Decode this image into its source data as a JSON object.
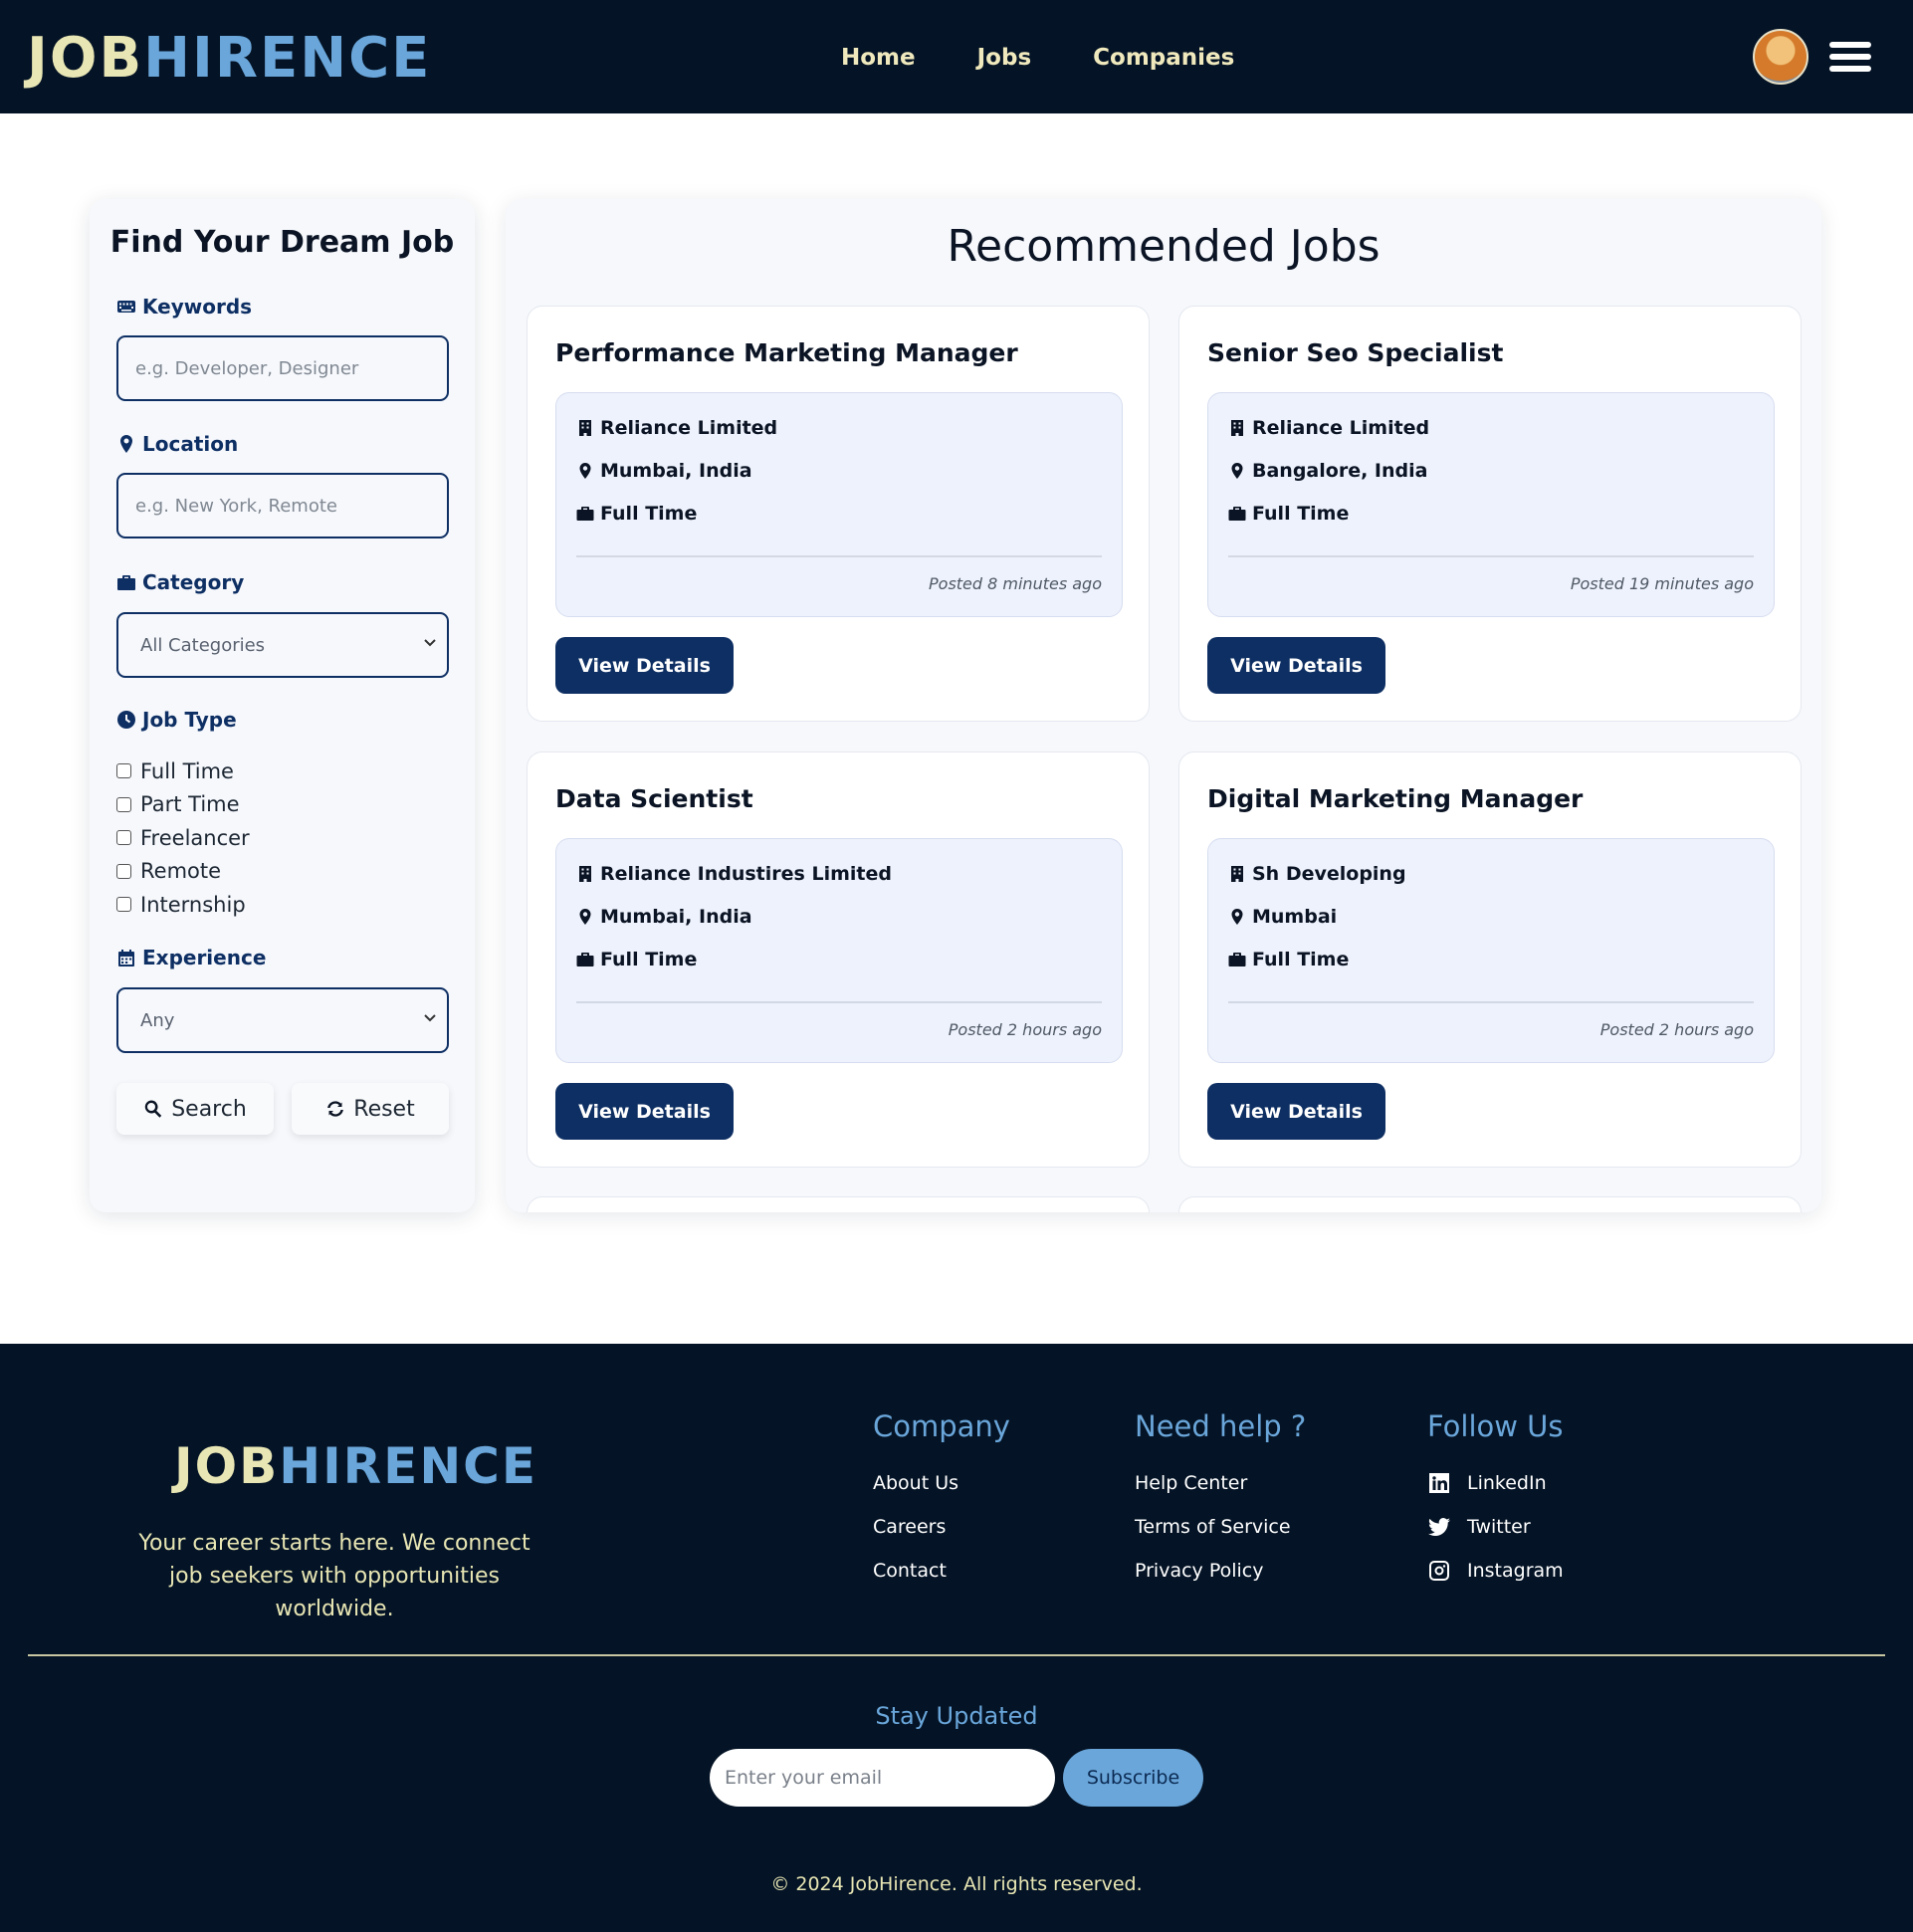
{
  "brand": {
    "logo_part1": "JOB",
    "logo_part2": "HIRENCE"
  },
  "nav": {
    "items": [
      "Home",
      "Jobs",
      "Companies"
    ]
  },
  "sidebar": {
    "title": "Find Your Dream Job",
    "keywords": {
      "label": "Keywords",
      "placeholder": "e.g. Developer, Designer"
    },
    "location": {
      "label": "Location",
      "placeholder": "e.g. New York, Remote"
    },
    "category": {
      "label": "Category",
      "selected": "All Categories"
    },
    "job_type": {
      "label": "Job Type",
      "options": [
        "Full Time",
        "Part Time",
        "Freelancer",
        "Remote",
        "Internship"
      ]
    },
    "experience": {
      "label": "Experience",
      "selected": "Any"
    },
    "search_label": "Search",
    "reset_label": "Reset"
  },
  "main": {
    "title": "Recommended Jobs",
    "view_details_label": "View Details",
    "jobs": [
      {
        "title": "Performance Marketing Manager",
        "company": "Reliance Limited",
        "location": "Mumbai, India",
        "type": "Full Time",
        "posted": "Posted 8 minutes ago"
      },
      {
        "title": "Senior Seo Specialist",
        "company": "Reliance Limited",
        "location": "Bangalore, India",
        "type": "Full Time",
        "posted": "Posted 19 minutes ago"
      },
      {
        "title": "Data Scientist",
        "company": "Reliance Industires Limited",
        "location": "Mumbai, India",
        "type": "Full Time",
        "posted": "Posted 2 hours ago"
      },
      {
        "title": "Digital Marketing Manager",
        "company": "Sh Developing",
        "location": "Mumbai",
        "type": "Full Time",
        "posted": "Posted 2 hours ago"
      }
    ]
  },
  "footer": {
    "tagline": "Your career starts here. We connect job seekers with opportunities worldwide.",
    "company": {
      "title": "Company",
      "links": [
        "About Us",
        "Careers",
        "Contact"
      ]
    },
    "help": {
      "title": "Need help ?",
      "links": [
        "Help Center",
        "Terms of Service",
        "Privacy Policy"
      ]
    },
    "follow": {
      "title": "Follow Us",
      "links": [
        {
          "label": "LinkedIn",
          "icon": "linkedin-icon"
        },
        {
          "label": "Twitter",
          "icon": "twitter-icon"
        },
        {
          "label": "Instagram",
          "icon": "instagram-icon"
        }
      ]
    },
    "stay_title": "Stay Updated",
    "email_placeholder": "Enter your email",
    "subscribe_label": "Subscribe",
    "copyright": "© 2024 JobHirence. All rights reserved."
  },
  "colors": {
    "navy": "#041325",
    "accent_blue": "#6aa6da",
    "cream": "#e8e6b4",
    "button_navy": "#0e2f63"
  }
}
